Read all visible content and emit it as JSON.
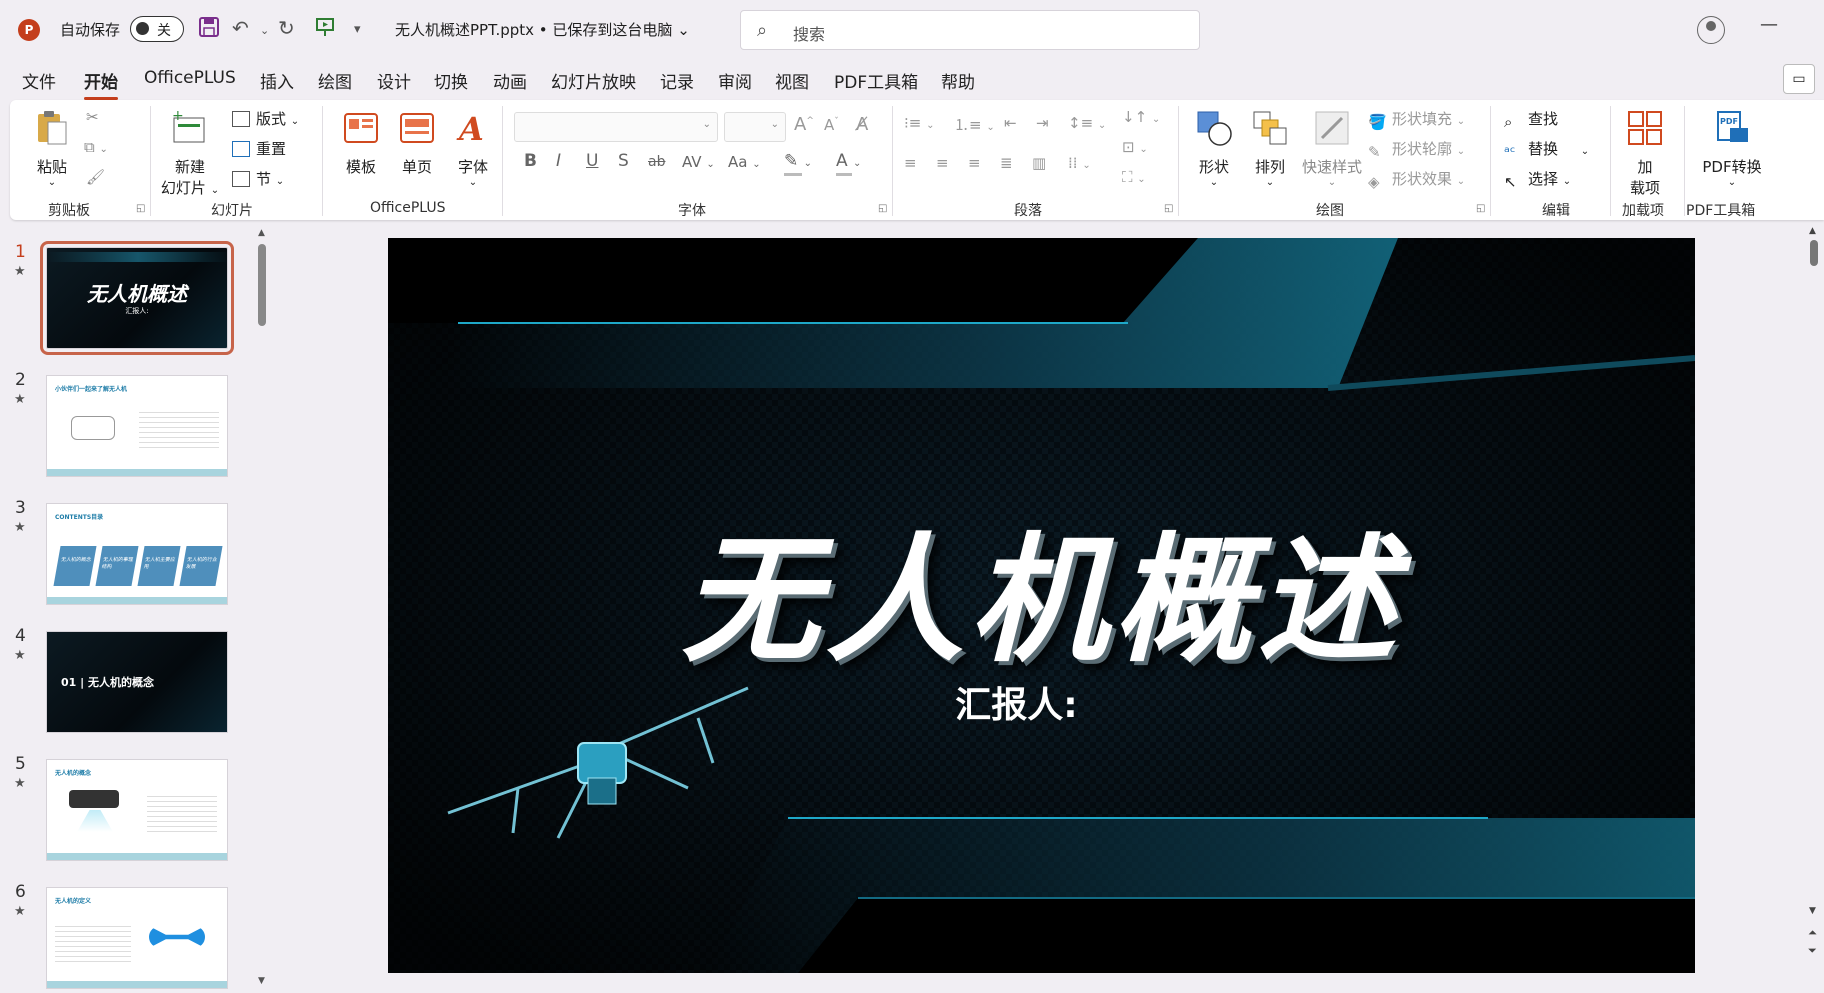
{
  "titlebar": {
    "app_icon": "P",
    "autosave_label": "自动保存",
    "autosave_state": "关",
    "doc_title": "无人机概述PPT.pptx • 已保存到这台电脑 ⌄",
    "search_placeholder": "搜索",
    "minimize": "—"
  },
  "menu": [
    "文件",
    "开始",
    "OfficePLUS",
    "插入",
    "绘图",
    "设计",
    "切换",
    "动画",
    "幻灯片放映",
    "记录",
    "审阅",
    "视图",
    "PDF工具箱",
    "帮助"
  ],
  "ribbon": {
    "clipboard": {
      "paste": "粘贴",
      "group": "剪贴板"
    },
    "slides": {
      "new_slide_1": "新建",
      "new_slide_2": "幻灯片",
      "layout": "版式",
      "reset": "重置",
      "section": "节",
      "group": "幻灯片"
    },
    "officeplus": {
      "template": "模板",
      "single": "单页",
      "font": "字体",
      "group": "OfficePLUS"
    },
    "font": {
      "group": "字体",
      "bold": "B",
      "italic": "I",
      "underline": "U",
      "shadow": "S",
      "strike": "ab",
      "spacing": "AV",
      "case": "Aa"
    },
    "paragraph": {
      "group": "段落"
    },
    "drawing": {
      "shape": "形状",
      "arrange": "排列",
      "quick_style": "快速样式",
      "fill": "形状填充",
      "outline": "形状轮廓",
      "effect": "形状效果",
      "group": "绘图"
    },
    "editing": {
      "find": "查找",
      "replace": "替换",
      "select": "选择",
      "group": "编辑"
    },
    "addins": {
      "label_1": "加",
      "label_2": "载项",
      "group": "加载项"
    },
    "pdf": {
      "label": "PDF转换",
      "group": "PDF工具箱"
    }
  },
  "thumbnails": [
    {
      "num": "1",
      "title": "无人机概述",
      "sub": "汇报人:"
    },
    {
      "num": "2",
      "header": "小伙伴们一起来了解无人机"
    },
    {
      "num": "3",
      "header": "CONTENTS目录",
      "items": [
        "无人机的概念",
        "无人机的事理结构",
        "无人机主要应用",
        "无人机的行业发展"
      ]
    },
    {
      "num": "4",
      "title": "01 | 无人机的概念"
    },
    {
      "num": "5",
      "header": "无人机的概念"
    },
    {
      "num": "6",
      "header": "无人机的定义"
    }
  ],
  "slide": {
    "title": "无人机概述",
    "subtitle": "汇报人:"
  },
  "colors": {
    "accent": "#c43e1c",
    "slide_bg": "#03080c",
    "cyan": "#18a6c4"
  }
}
